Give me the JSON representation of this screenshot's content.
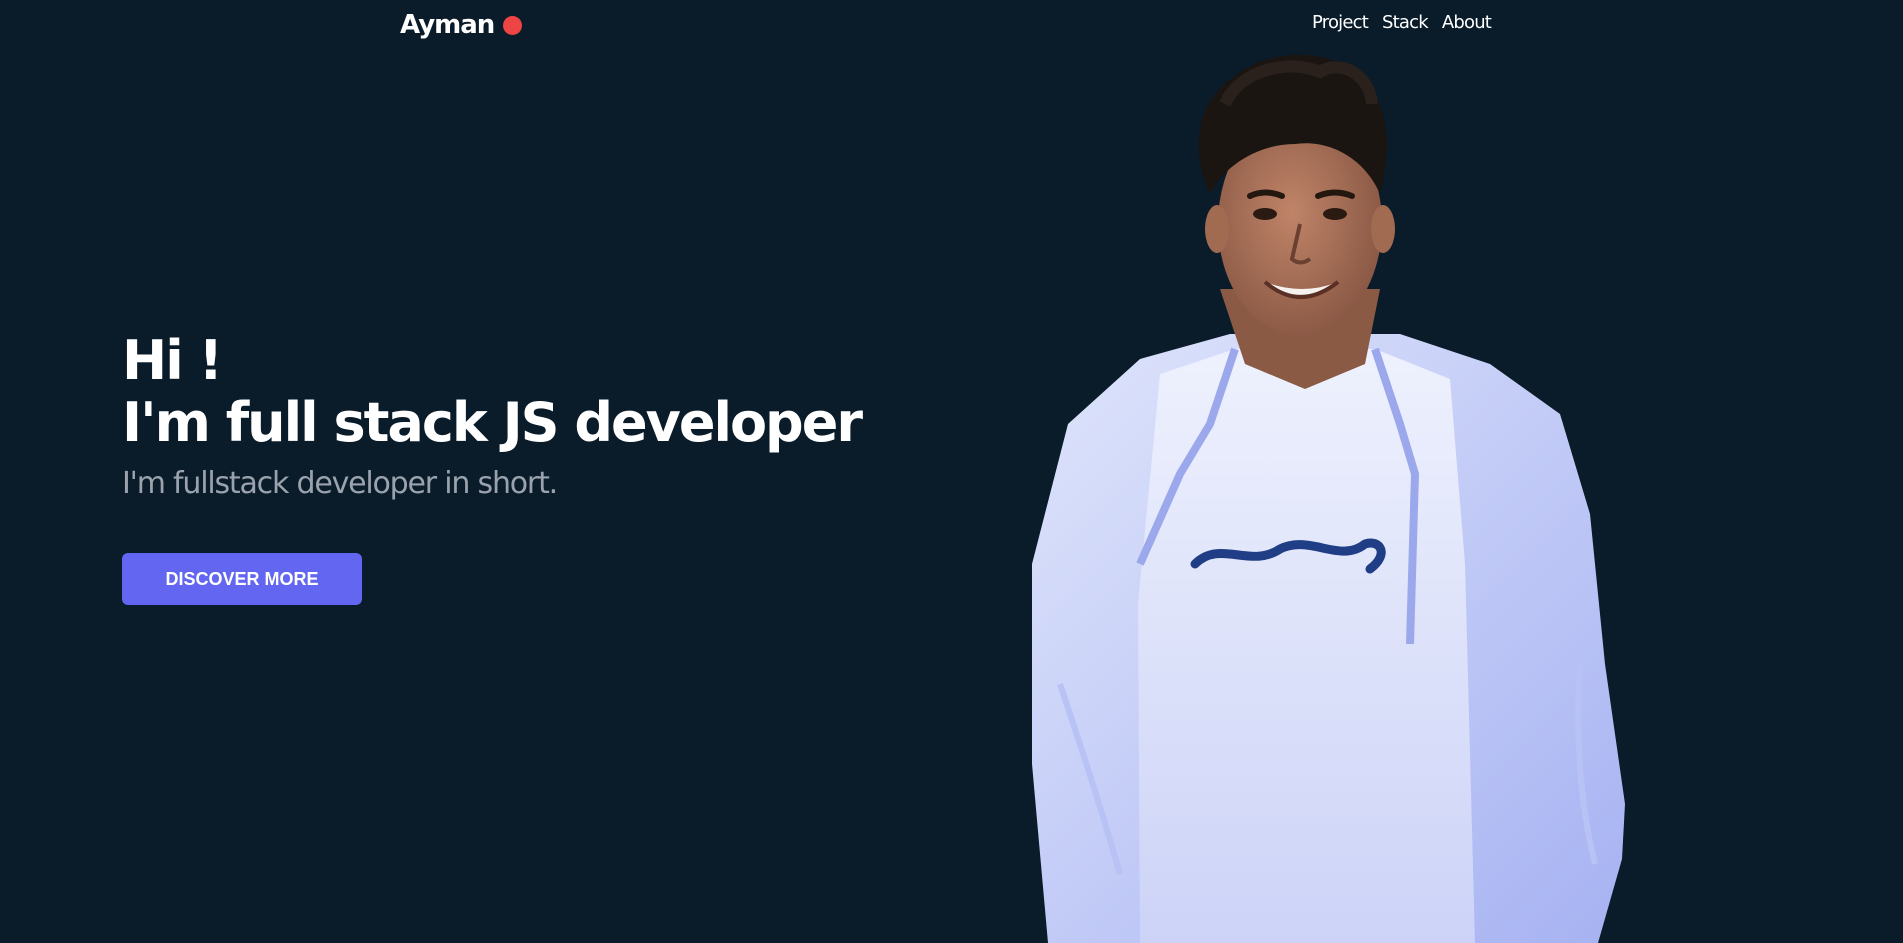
{
  "brand": {
    "name": "Ayman",
    "dot_color": "#ef4444"
  },
  "nav": {
    "items": [
      {
        "label": "Project"
      },
      {
        "label": "Stack"
      },
      {
        "label": "About"
      }
    ]
  },
  "hero": {
    "greeting": "Hi !",
    "headline": "I'm full stack JS developer",
    "subtitle": "I'm fullstack developer in short.",
    "cta_label": "DISCOVER MORE"
  },
  "portrait": {
    "icon": "person-portrait-icon"
  },
  "colors": {
    "background": "#0a1b29",
    "accent": "#6366f1",
    "subtitle": "#9aa3ad",
    "dot": "#ef4444"
  }
}
